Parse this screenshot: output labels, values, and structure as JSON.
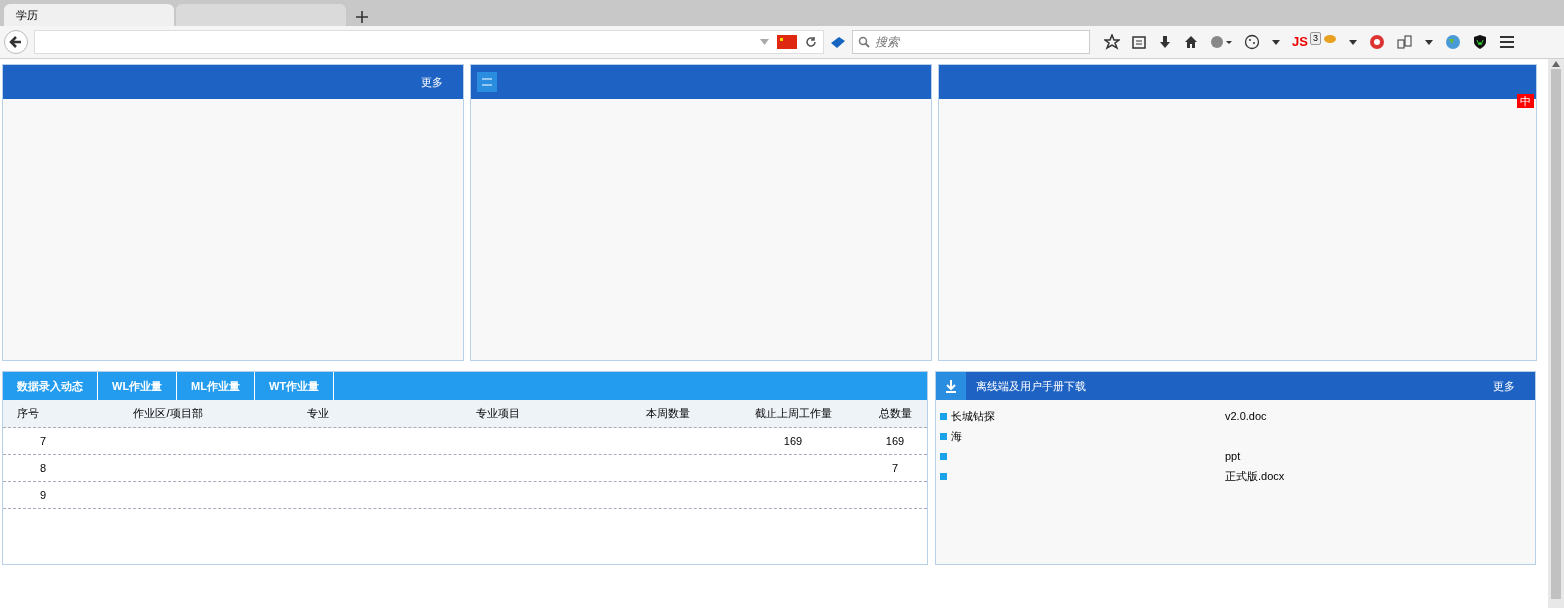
{
  "browser": {
    "tabs": [
      {
        "label": "学历",
        "selected": true
      },
      {
        "selected": false
      }
    ],
    "search": {
      "placeholder": "搜索"
    },
    "toolbar_badge": "3",
    "script_label": "JS"
  },
  "top_panels": [
    {
      "more": "更多"
    },
    {
      "icon": true
    },
    {
      "badge": "中"
    }
  ],
  "data_tabs": [
    "数据录入动态",
    "WL作业量",
    "ML作业量",
    "WT作业量"
  ],
  "table": {
    "columns": [
      "序号",
      "作业区/项目部",
      "专业",
      "专业项目",
      "本周数量",
      "截止上周工作量",
      "总数量"
    ],
    "rows": [
      {
        "index": "7",
        "last_week": "169",
        "total": "169"
      },
      {
        "index": "8",
        "total": "7"
      },
      {
        "index": "9"
      }
    ]
  },
  "downloads": {
    "title": "离线端及用户手册下载",
    "more": "更多",
    "items": [
      {
        "text": "长城钻探",
        "tail": "v2.0.doc"
      },
      {
        "text": "海"
      },
      {
        "tail": "ppt"
      },
      {
        "tail": "正式版.docx"
      }
    ]
  }
}
